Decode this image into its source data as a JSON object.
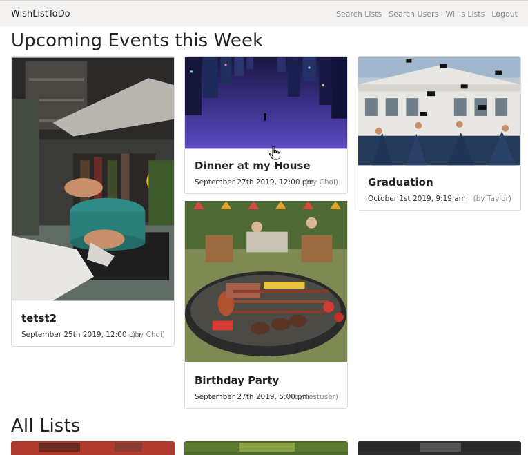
{
  "navbar": {
    "brand": "WishListToDo",
    "links": [
      "Search Lists",
      "Search Users",
      "Will's Lists",
      "Logout"
    ]
  },
  "sections": {
    "upcoming_title": "Upcoming Events this Week",
    "all_lists_title": "All Lists"
  },
  "events": [
    {
      "title": "tetst2",
      "date": "September 25th 2019, 12:00 pm",
      "by": "(by Choi)",
      "image": "kitchen-cooking-photo"
    },
    {
      "title": "Dinner at my House",
      "date": "September 27th 2019, 12:00 pm",
      "by": "(by Choi)",
      "image": "upside-down-city-photo"
    },
    {
      "title": "Graduation",
      "date": "October 1st 2019, 9:19 am",
      "by": "(by Taylor)",
      "image": "graduation-caps-photo"
    },
    {
      "title": "Birthday Party",
      "date": "September 27th 2019, 5:00 pm",
      "by": "(by testuser)",
      "image": "barbecue-grill-photo"
    }
  ]
}
